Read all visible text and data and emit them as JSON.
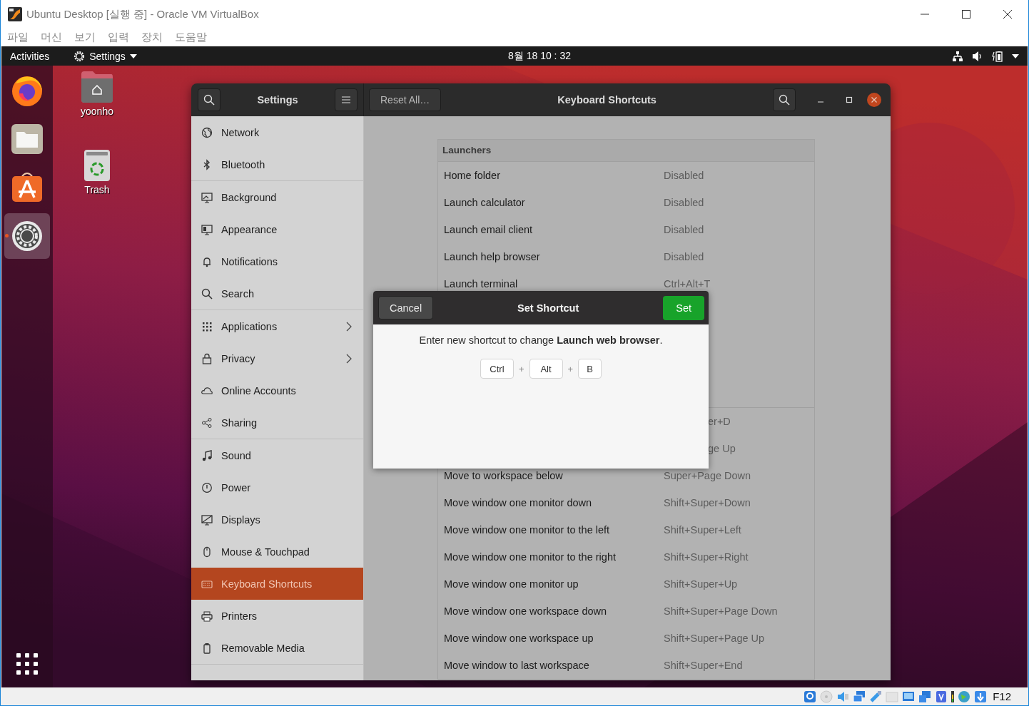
{
  "window": {
    "title": "Ubuntu Desktop [실행 중] - Oracle VM VirtualBox"
  },
  "menu": [
    "파일",
    "머신",
    "보기",
    "입력",
    "장치",
    "도움말"
  ],
  "top_bar": {
    "activities": "Activities",
    "app_menu": "Settings",
    "clock": "8월 18  10 : 32"
  },
  "dock": [
    {
      "selected": false
    },
    {
      "selected": false
    },
    {
      "selected": false
    },
    {
      "selected": true
    }
  ],
  "desktop_icons": [
    {
      "label": "yoonho",
      "kind": "home-folder"
    },
    {
      "label": "Trash",
      "kind": "trash"
    }
  ],
  "settings": {
    "title": "Settings",
    "reset_button": "Reset All…",
    "page_title": "Keyboard Shortcuts",
    "sidebar": [
      {
        "items": [
          {
            "label": "Network",
            "selected": false,
            "submenu": false
          },
          {
            "label": "Bluetooth",
            "selected": false,
            "submenu": false
          }
        ]
      },
      {
        "items": [
          {
            "label": "Background",
            "selected": false,
            "submenu": false
          },
          {
            "label": "Appearance",
            "selected": false,
            "submenu": false
          },
          {
            "label": "Notifications",
            "selected": false,
            "submenu": false
          },
          {
            "label": "Search",
            "selected": false,
            "submenu": false
          }
        ]
      },
      {
        "items": [
          {
            "label": "Applications",
            "selected": false,
            "submenu": true
          },
          {
            "label": "Privacy",
            "selected": false,
            "submenu": true
          },
          {
            "label": "Online Accounts",
            "selected": false,
            "submenu": false
          },
          {
            "label": "Sharing",
            "selected": false,
            "submenu": false
          }
        ]
      },
      {
        "items": [
          {
            "label": "Sound",
            "selected": false,
            "submenu": false
          },
          {
            "label": "Power",
            "selected": false,
            "submenu": false
          },
          {
            "label": "Displays",
            "selected": false,
            "submenu": false
          },
          {
            "label": "Mouse & Touchpad",
            "selected": false,
            "submenu": false
          },
          {
            "label": "Keyboard Shortcuts",
            "selected": true,
            "submenu": false
          },
          {
            "label": "Printers",
            "selected": false,
            "submenu": false
          },
          {
            "label": "Removable Media",
            "selected": false,
            "submenu": false
          }
        ]
      }
    ],
    "shortcuts": [
      {
        "title": "Launchers",
        "rows": [
          {
            "name": "Home folder",
            "shortcut": "Disabled"
          },
          {
            "name": "Launch calculator",
            "shortcut": "Disabled"
          },
          {
            "name": "Launch email client",
            "shortcut": "Disabled"
          },
          {
            "name": "Launch help browser",
            "shortcut": "Disabled"
          },
          {
            "name": "Launch terminal",
            "shortcut": "Ctrl+Alt+T"
          }
        ]
      },
      {
        "rows": [
          {
            "shortcut": "er+D"
          },
          {
            "shortcut": "ge Up"
          },
          {
            "name": "Move to workspace below",
            "shortcut": "Super+Page Down"
          },
          {
            "name": "Move window one monitor down",
            "shortcut": "Shift+Super+Down"
          },
          {
            "name": "Move window one monitor to the left",
            "shortcut": "Shift+Super+Left"
          },
          {
            "name": "Move window one monitor to the right",
            "shortcut": "Shift+Super+Right"
          },
          {
            "name": "Move window one monitor up",
            "shortcut": "Shift+Super+Up"
          },
          {
            "name": "Move window one workspace down",
            "shortcut": "Shift+Super+Page Down"
          },
          {
            "name": "Move window one workspace up",
            "shortcut": "Shift+Super+Page Up"
          },
          {
            "name": "Move window to last workspace",
            "shortcut": "Shift+Super+End"
          }
        ]
      }
    ]
  },
  "dialog": {
    "cancel": "Cancel",
    "title": "Set Shortcut",
    "set": "Set",
    "message": "Enter new shortcut to change **Launch web browser**.",
    "keys": [
      "Ctrl",
      "Alt",
      "B"
    ],
    "joiners": [
      "+",
      "+"
    ]
  },
  "status_bar": {
    "host_key": "F12"
  }
}
